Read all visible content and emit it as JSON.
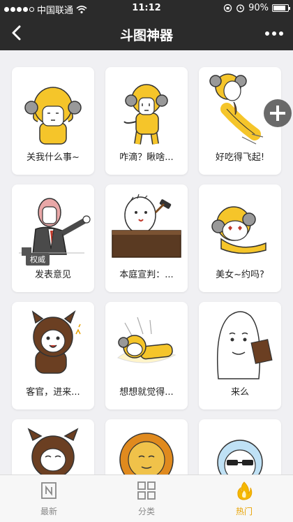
{
  "status_bar": {
    "carrier": "中国联通",
    "time": "11:12",
    "battery": "90%"
  },
  "nav": {
    "title": "斗图神器"
  },
  "tag_label": "权威",
  "stickers": [
    {
      "label": "关我什么事~"
    },
    {
      "label": "咋滴？瞅啥..."
    },
    {
      "label": "好吃得飞起!"
    },
    {
      "label": "发表意见"
    },
    {
      "label": "本庭宣判：..."
    },
    {
      "label": "美女~约吗?"
    },
    {
      "label": "客官，进来..."
    },
    {
      "label": "想想就觉得..."
    },
    {
      "label": "来么"
    },
    {
      "label": ""
    },
    {
      "label": ""
    },
    {
      "label": ""
    }
  ],
  "tabs": [
    {
      "label": "最新",
      "icon": "new-icon"
    },
    {
      "label": "分类",
      "icon": "category-grid-icon"
    },
    {
      "label": "热门",
      "icon": "fire-icon"
    }
  ],
  "colors": {
    "bar": "#2b2b2b",
    "accent": "#e8a200",
    "sheep_yellow": "#f5c52a"
  }
}
